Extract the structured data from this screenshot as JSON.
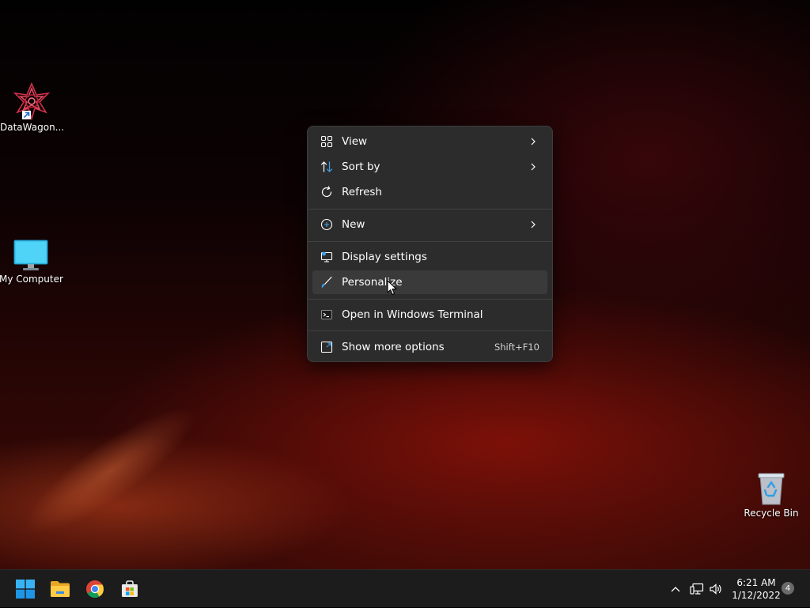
{
  "desktop": {
    "icons": [
      {
        "label": "DataWagon...",
        "icon": "datawagon-app-icon"
      },
      {
        "label": "My Computer",
        "icon": "monitor-icon"
      },
      {
        "label": "Recycle Bin",
        "icon": "recycle-bin-icon"
      }
    ]
  },
  "context_menu": {
    "items": [
      {
        "label": "View",
        "icon": "grid-icon",
        "submenu": true
      },
      {
        "label": "Sort by",
        "icon": "sort-icon",
        "submenu": true
      },
      {
        "label": "Refresh",
        "icon": "refresh-icon"
      },
      {
        "label": "New",
        "icon": "plus-circle-icon",
        "submenu": true
      },
      {
        "label": "Display settings",
        "icon": "display-settings-icon"
      },
      {
        "label": "Personalize",
        "icon": "brush-icon",
        "highlighted": true
      },
      {
        "label": "Open in Windows Terminal",
        "icon": "terminal-icon"
      },
      {
        "label": "Show more options",
        "icon": "expand-icon",
        "shortcut": "Shift+F10"
      }
    ]
  },
  "taskbar": {
    "apps": [
      {
        "name": "Start",
        "icon": "windows-start-icon"
      },
      {
        "name": "File Explorer",
        "icon": "folder-icon"
      },
      {
        "name": "Chrome",
        "icon": "chrome-icon"
      },
      {
        "name": "Microsoft Store",
        "icon": "store-icon"
      }
    ],
    "tray": {
      "icons": [
        "chevron-up-icon",
        "network-icon",
        "volume-icon"
      ],
      "time": "6:21 AM",
      "date": "1/12/2022",
      "notification_count": "4"
    }
  },
  "colors": {
    "menu_bg": "#2c2c2c",
    "menu_hover": "#3a3a3a",
    "taskbar_bg": "#1c1c1c",
    "accent": "#3aa3ee"
  }
}
